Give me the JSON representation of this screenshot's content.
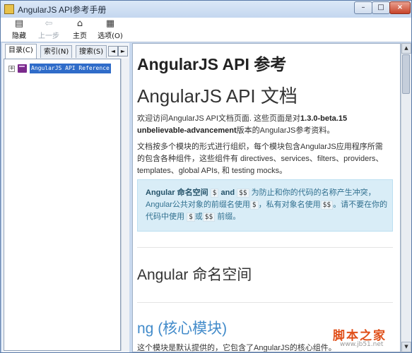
{
  "window": {
    "title": "AngularJS API参考手册",
    "controls": {
      "minimize": "–",
      "maximize": "□",
      "close": "×"
    }
  },
  "toolbar": {
    "items": [
      {
        "label": "隐藏",
        "icon": "hide-pane-icon",
        "glyph": "▤",
        "enabled": true
      },
      {
        "label": "上一步",
        "icon": "back-arrow-icon",
        "glyph": "⇦",
        "enabled": false
      },
      {
        "label": "主页",
        "icon": "home-icon",
        "glyph": "⌂",
        "enabled": true
      },
      {
        "label": "选项(O)",
        "icon": "options-icon",
        "glyph": "▦",
        "enabled": true
      }
    ]
  },
  "nav": {
    "tabs": [
      {
        "label": "目录(C)",
        "active": true
      },
      {
        "label": "索引(N)",
        "active": false
      },
      {
        "label": "搜索(S)",
        "active": false
      }
    ],
    "tab_scroll": {
      "left": "◄",
      "right": "►"
    },
    "tree": [
      {
        "expander": "+",
        "icon": "book-icon",
        "label": "AngularJS API Reference",
        "selected": true
      }
    ]
  },
  "content": {
    "page_heading": "AngularJS API 参考",
    "section_title": "AngularJS API 文档",
    "intro": {
      "before": "欢迎访问AngularJS API文档页面. 这些页面是对",
      "version": "1.3.0-beta.15 unbelievable-advancement",
      "after": "版本的AngularJS参考资料。"
    },
    "modules_paragraph": "文档按多个模块的形式进行组织，每个模块包含AngularJS应用程序所需的包含各种组件，这些组件有  directives、services、filters、providers、templates、global APIs, 和  testing mocks。",
    "alert": {
      "strong": "Angular 命名空间",
      "code_dollar": "$",
      "and": "and",
      "code_double": "$$",
      "text1": "为防止和你的代码的名称产生冲突，Angular公共对象的前缀名使用",
      "text2": "，私有对象名使用",
      "text3": "。请不要在你的代码中使用",
      "or": "或",
      "text4": "前缀。"
    },
    "namespace_heading": "Angular 命名空间",
    "core_heading": "ng (核心模块)",
    "core_text": "这个模块是默认提供的，它包含了AngularJS的核心组件。"
  },
  "scrollbar": {
    "up": "▲",
    "down": "▼"
  },
  "watermark": {
    "main": "脚本之家",
    "url": "www.jb51.net"
  },
  "colors": {
    "title_bar": "#c4d7ef",
    "selection": "#2f6cc9",
    "alert_bg": "#d9edf7",
    "alert_text": "#31708f",
    "link": "#428bca",
    "watermark": "#e0501a"
  }
}
